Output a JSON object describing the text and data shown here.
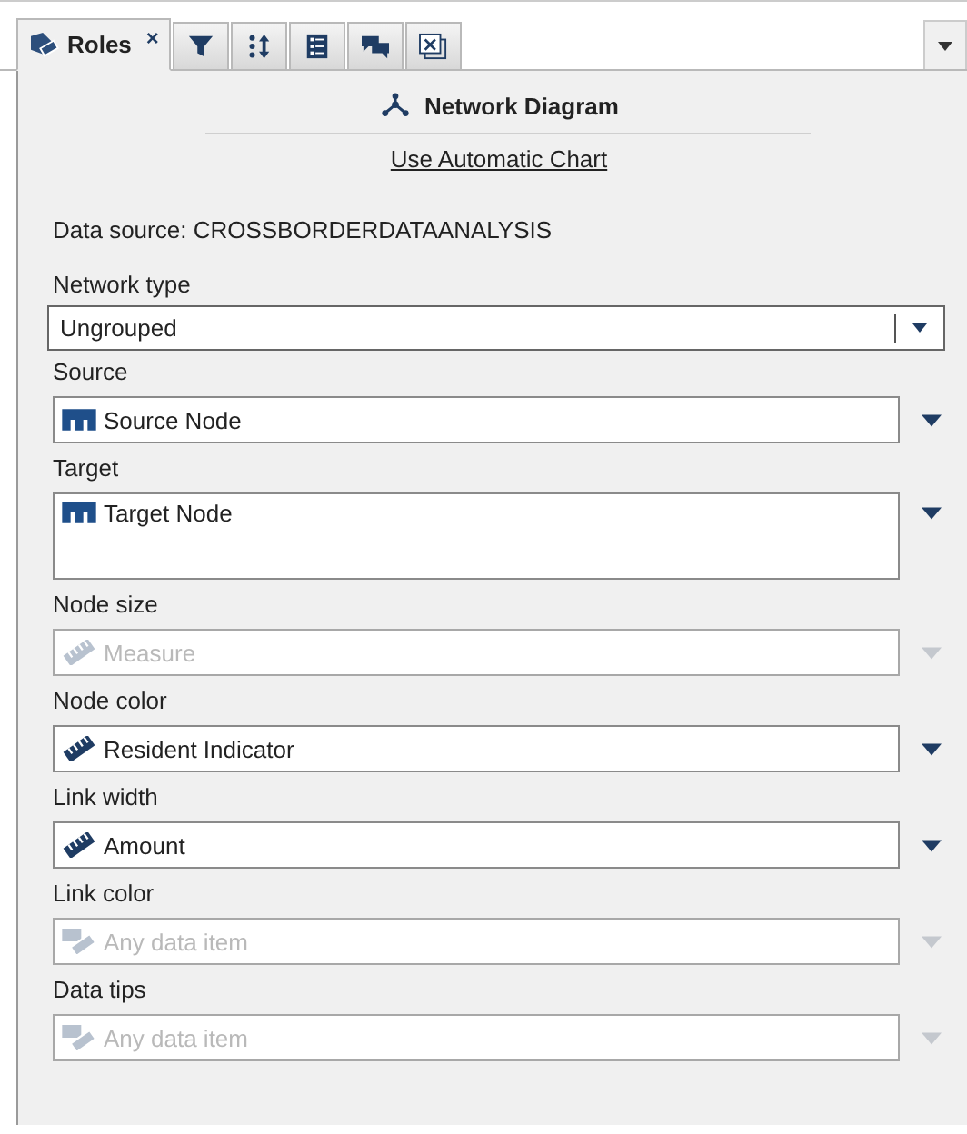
{
  "tabs": [
    {
      "kind": "roles",
      "label": "Roles",
      "close": "×",
      "selected": true
    },
    {
      "kind": "filter",
      "selected": false
    },
    {
      "kind": "rank",
      "selected": false
    },
    {
      "kind": "details",
      "selected": false
    },
    {
      "kind": "comments",
      "selected": false
    },
    {
      "kind": "formula",
      "selected": false
    }
  ],
  "header": {
    "title": "Network Diagram",
    "link": "Use Automatic Chart"
  },
  "data_source": "Data source:  CROSSBORDERDATAANALYSIS",
  "roles": [
    {
      "label": "Network type",
      "kind": "combo",
      "value": "Ungrouped"
    },
    {
      "label": "Source",
      "kind": "category",
      "value": "Source Node",
      "disabled": false,
      "multiline": false
    },
    {
      "label": "Target",
      "kind": "category",
      "value": "Target Node",
      "disabled": false,
      "multiline": true
    },
    {
      "label": "Node size",
      "kind": "measure",
      "placeholder": "Measure",
      "disabled": true,
      "multiline": false
    },
    {
      "label": "Node color",
      "kind": "measure",
      "value": "Resident Indicator",
      "disabled": false,
      "multiline": false
    },
    {
      "label": "Link width",
      "kind": "measure",
      "value": "Amount",
      "disabled": false,
      "multiline": false
    },
    {
      "label": "Link color",
      "kind": "any",
      "placeholder": "Any data item",
      "disabled": true,
      "multiline": false
    },
    {
      "label": "Data tips",
      "kind": "any",
      "placeholder": "Any data item",
      "disabled": true,
      "multiline": false
    }
  ]
}
